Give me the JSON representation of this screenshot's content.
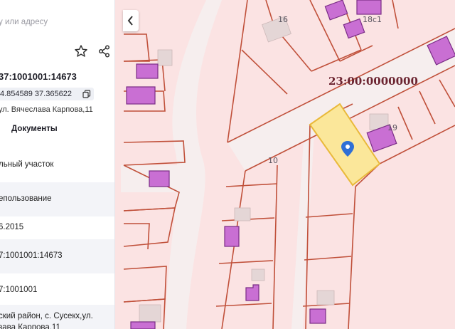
{
  "panel": {
    "search_placeholder": "у или адресу",
    "cadastral_number": "37:1001001:14673",
    "coordinates": "4.854589 37.365622",
    "address": "ул. Вячеслава Карпова,11",
    "documents_tab": "Документы",
    "rows": [
      "льный участок",
      "епользование",
      "6.2015",
      "7:1001001:14673",
      "7:1001001",
      "ский район, с. Сусекх,ул.",
      "зава Карпова,11"
    ]
  },
  "map": {
    "cadastral_block_label": "23:00:0000000",
    "house_numbers": [
      "16",
      "18с1",
      "19",
      "10"
    ],
    "colors": {
      "background": "#fbe3e3",
      "road": "#f6eeee",
      "parcel_border": "#c0503a",
      "building_fill": "#c96fd3",
      "building_border": "#7a2d86",
      "selected_fill": "#fbe79a",
      "selected_border": "#e9b93a",
      "pin": "#2f6fd6"
    },
    "icons": [
      "back-chevron-icon",
      "star-icon",
      "share-icon",
      "copy-icon",
      "location-pin-icon"
    ]
  }
}
